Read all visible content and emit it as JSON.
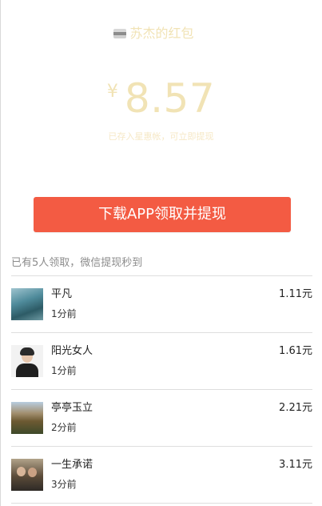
{
  "envelope": {
    "sender_name": "苏杰的红包",
    "currency_symbol": "¥",
    "amount": "8.57",
    "note": "已存入星惠帐，可立即提现",
    "cta_label": "下载APP领取并提现"
  },
  "claims": {
    "summary": "已有5人领取，微信提现秒到",
    "items": [
      {
        "name": "平凡",
        "time": "1分前",
        "amount": "1.11元"
      },
      {
        "name": "阳光女人",
        "time": "1分前",
        "amount": "1.61元"
      },
      {
        "name": "亭亭玉立",
        "time": "2分前",
        "amount": "2.21元"
      },
      {
        "name": "一生承诺",
        "time": "3分前",
        "amount": "3.11元"
      }
    ]
  },
  "colors": {
    "accent": "#f35b43",
    "amount_text": "#f1e3b5",
    "divider": "#dedede"
  }
}
